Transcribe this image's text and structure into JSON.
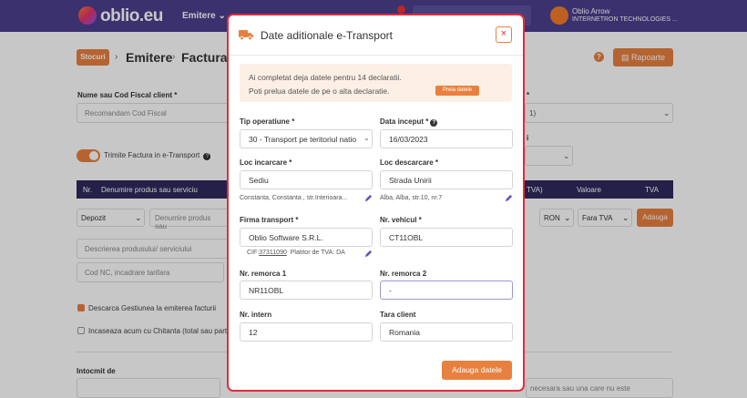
{
  "topbar": {
    "logo_text": "oblio.eu",
    "nav_emitere": "Emitere",
    "user_name": "Oblio Arrow",
    "user_company": "INTERNETRON TECHNOLOGIES ..."
  },
  "page": {
    "btn_stocuri": "Stocuri",
    "crumb_emitere": "Emitere",
    "crumb_factura": "Factura",
    "btn_rapoarte": "Rapoarte",
    "client_label": "Nume sau Cod Fiscal client *",
    "client_placeholder": "Recomandam Cod Fiscal",
    "right_star": "*",
    "right_select_value": "1)",
    "trimite_label": "Trimite Factura in e-Transport",
    "right_i_label": "i",
    "table_headers": [
      "Nr.",
      "Denumire produs sau serviciu",
      "TVA)",
      "Valoare",
      "TVA"
    ],
    "depozit": "Depozit",
    "denumire_placeholder": "Denumire produs sau",
    "currency": "RON",
    "tva_select": "Fara TVA",
    "btn_adauga": "Adauga",
    "descriere_placeholder": "Descrierea produsului/ serviciului",
    "nc_placeholder": "Cod NC, incadrare tarifara",
    "descarca_label": "Descarca Gestiunea la emiterea facturii",
    "incaseaza_label": "Incaseaza acum cu Chitanta (total sau parti",
    "intocmit_label": "Intocmit de",
    "notes_text": "necesara sau una care nu este"
  },
  "modal": {
    "title": "Date aditionale e-Transport",
    "close_symbol": "×",
    "info_line1": "Ai completat deja datele pentru 14 declaratii.",
    "info_line2": "Poti prelua datele de pe o alta declaratie.",
    "btn_preia": "Preia datele",
    "tip_operatiune_label": "Tip operatiune *",
    "tip_operatiune_value": "30 - Transport pe teritoriul natio",
    "data_inceput_label": "Data inceput *",
    "data_inceput_value": "16/03/2023",
    "loc_incarcare_label": "Loc incarcare *",
    "loc_incarcare_value": "Sediu",
    "loc_incarcare_detail": "Constanta, Constanta , str.Interioara...",
    "loc_descarcare_label": "Loc descarcare *",
    "loc_descarcare_value": "Strada Unirii",
    "loc_descarcare_detail": "Alba, Alba, str.10, nr.7",
    "firma_label": "Firma transport *",
    "firma_value": "Oblio Software S.R.L.",
    "firma_cif_prefix": "CIF:",
    "firma_cif": "37311090",
    "firma_tva": "Platitor de TVA: DA",
    "vehicul_label": "Nr. vehicul *",
    "vehicul_value": "CT11OBL",
    "remorca1_label": "Nr. remorca 1",
    "remorca1_value": "NR11OBL",
    "remorca2_label": "Nr. remorca 2",
    "remorca2_value": "-",
    "intern_label": "Nr. intern",
    "intern_value": "12",
    "tara_label": "Tara client",
    "tara_value": "Romania",
    "btn_adauga_datele": "Adauga datele"
  },
  "colors": {
    "accent": "#e8813f",
    "header": "#4c3f8f",
    "table_header": "#2f2a5e",
    "modal_border": "#e32b3a"
  }
}
